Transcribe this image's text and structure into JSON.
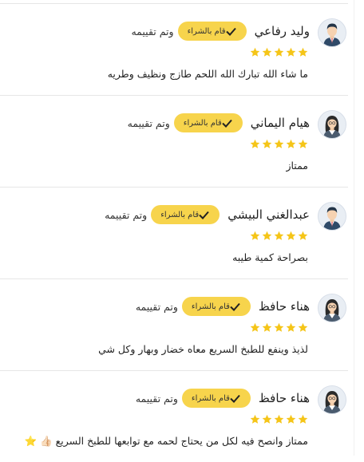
{
  "reviews": [
    {
      "name": "وليد رفاعي",
      "badge": "قام بالشراء",
      "rated": "وتم تقييمه",
      "avatar": "male-avatar",
      "rating": 5,
      "text": "ما شاء الله تبارك الله اللحم طازج ونظيف وطريه"
    },
    {
      "name": "هيام اليماني",
      "badge": "قام بالشراء",
      "rated": "وتم تقييمه",
      "avatar": "female-avatar",
      "rating": 5,
      "text": "ممتاز"
    },
    {
      "name": "عبدالغني البيشي",
      "badge": "قام بالشراء",
      "rated": "وتم تقييمه",
      "avatar": "male-avatar",
      "rating": 5,
      "text": "بصراحة كمية طيبه"
    },
    {
      "name": "هناء حافظ",
      "badge": "قام بالشراء",
      "rated": "وتم تقييمه",
      "avatar": "female-avatar",
      "rating": 5,
      "text": "لذيذ وينفع للطبخ السريع معاه خضار وبهار وكل شي"
    },
    {
      "name": "هناء حافظ",
      "badge": "قام بالشراء",
      "rated": "وتم تقييمه",
      "avatar": "female-avatar",
      "rating": 5,
      "text": "ممتاز وانصح فيه لكل من يحتاج لحمه مع توابعها للطبخ السريع 👍🏻 ⭐"
    }
  ],
  "colors": {
    "badge": "#f7d44c",
    "star": "#f5c518"
  }
}
